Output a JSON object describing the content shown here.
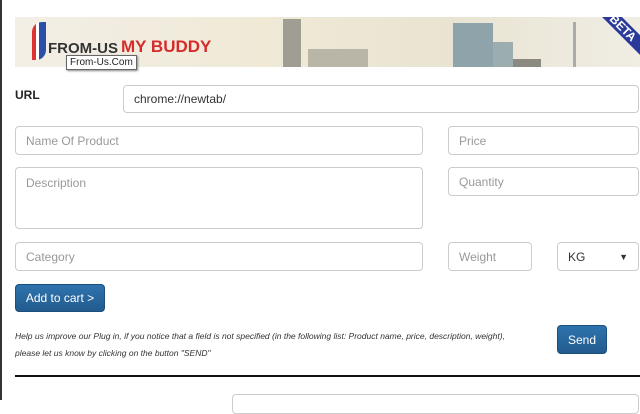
{
  "header": {
    "logo_text_1": "FROM-US",
    "logo_text_2": "MY BUDDY",
    "tooltip": "From-Us.Com",
    "badge": "BETA"
  },
  "form": {
    "url_label": "URL",
    "url_value": "chrome://newtab/",
    "name_placeholder": "Name Of Product",
    "price_placeholder": "Price",
    "description_placeholder": "Description",
    "quantity_placeholder": "Quantity",
    "category_placeholder": "Category",
    "weight_placeholder": "Weight",
    "unit_value": "KG",
    "add_to_cart": "Add to cart >"
  },
  "help": {
    "text": "Help us improve our Plug in, if you notice that a field is not specified (in the following list: Product name, price, description, weight), please let us know by clicking on the button \"SEND\"",
    "send": "Send"
  }
}
